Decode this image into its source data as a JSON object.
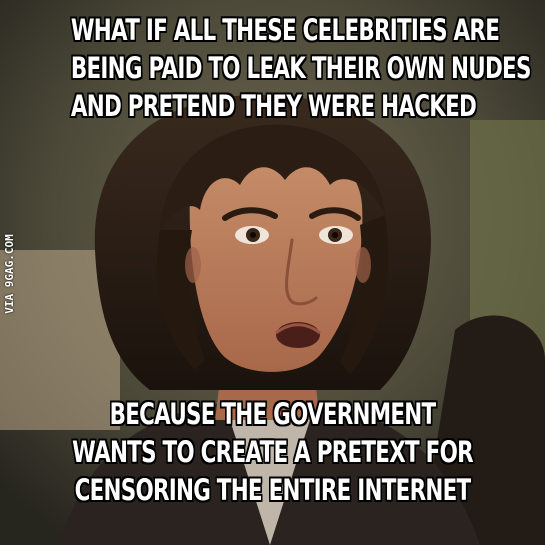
{
  "meme": {
    "top_text": [
      "WHAT IF ALL THESE CELEBRITIES ARE",
      "BEING PAID TO LEAK THEIR OWN NUDES",
      "AND PRETEND THEY WERE HACKED"
    ],
    "bottom_text": [
      "BECAUSE THE GOVERNMENT",
      "WANTS TO CREATE A PRETEXT FOR",
      "CENSORING THE ENTIRE INTERNET"
    ],
    "watermark": "VIA 9GAG.COM"
  }
}
